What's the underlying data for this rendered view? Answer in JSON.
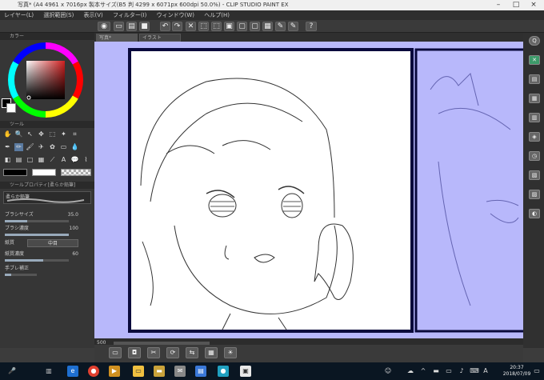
{
  "titlebar": {
    "title": "写真* (A4 4961 x 7016px 製本サイズ(B5 判 4299 x 6071px 600dpi 50.0%)  - CLIP STUDIO PAINT EX",
    "minimize": "–",
    "maximize": "□",
    "close": "×"
  },
  "menu": {
    "items": [
      "レイヤー(L)",
      "選択範囲(S)",
      "表示(V)",
      "フィルター(I)",
      "ウィンドウ(W)",
      "ヘルプ(H)"
    ]
  },
  "tabs": {
    "doc1": "写真*",
    "doc2": "イラスト"
  },
  "panels": {
    "color_header": "カラー",
    "tool_header": "ツール",
    "subtool_header": "ツールプロパティ[柔らか鉛筆]",
    "subtool_name": "柔らか鉛筆"
  },
  "tool_property": {
    "brush_size_label": "ブラシサイズ",
    "brush_size_value": "35.0",
    "brush_density_label": "ブラシ濃度",
    "brush_density_value": "100",
    "paper_label": "紙質",
    "paper_value": "中目",
    "paper_density_label": "紙質濃度",
    "paper_density_value": "60",
    "stabilization_label": "手ブレ補正",
    "brush_size_fraction": 0.35,
    "brush_density_fraction": 1.0,
    "paper_density_fraction": 0.6
  },
  "statusbar": {
    "zoom": "500"
  },
  "taskbar": {
    "time": "20:37",
    "date": "2018/07/09",
    "ime": "A"
  },
  "colors": {
    "canvas_bg": "#b8b8fb",
    "frame_border": "#0a0a3c",
    "accent": "#7a9cc6"
  }
}
